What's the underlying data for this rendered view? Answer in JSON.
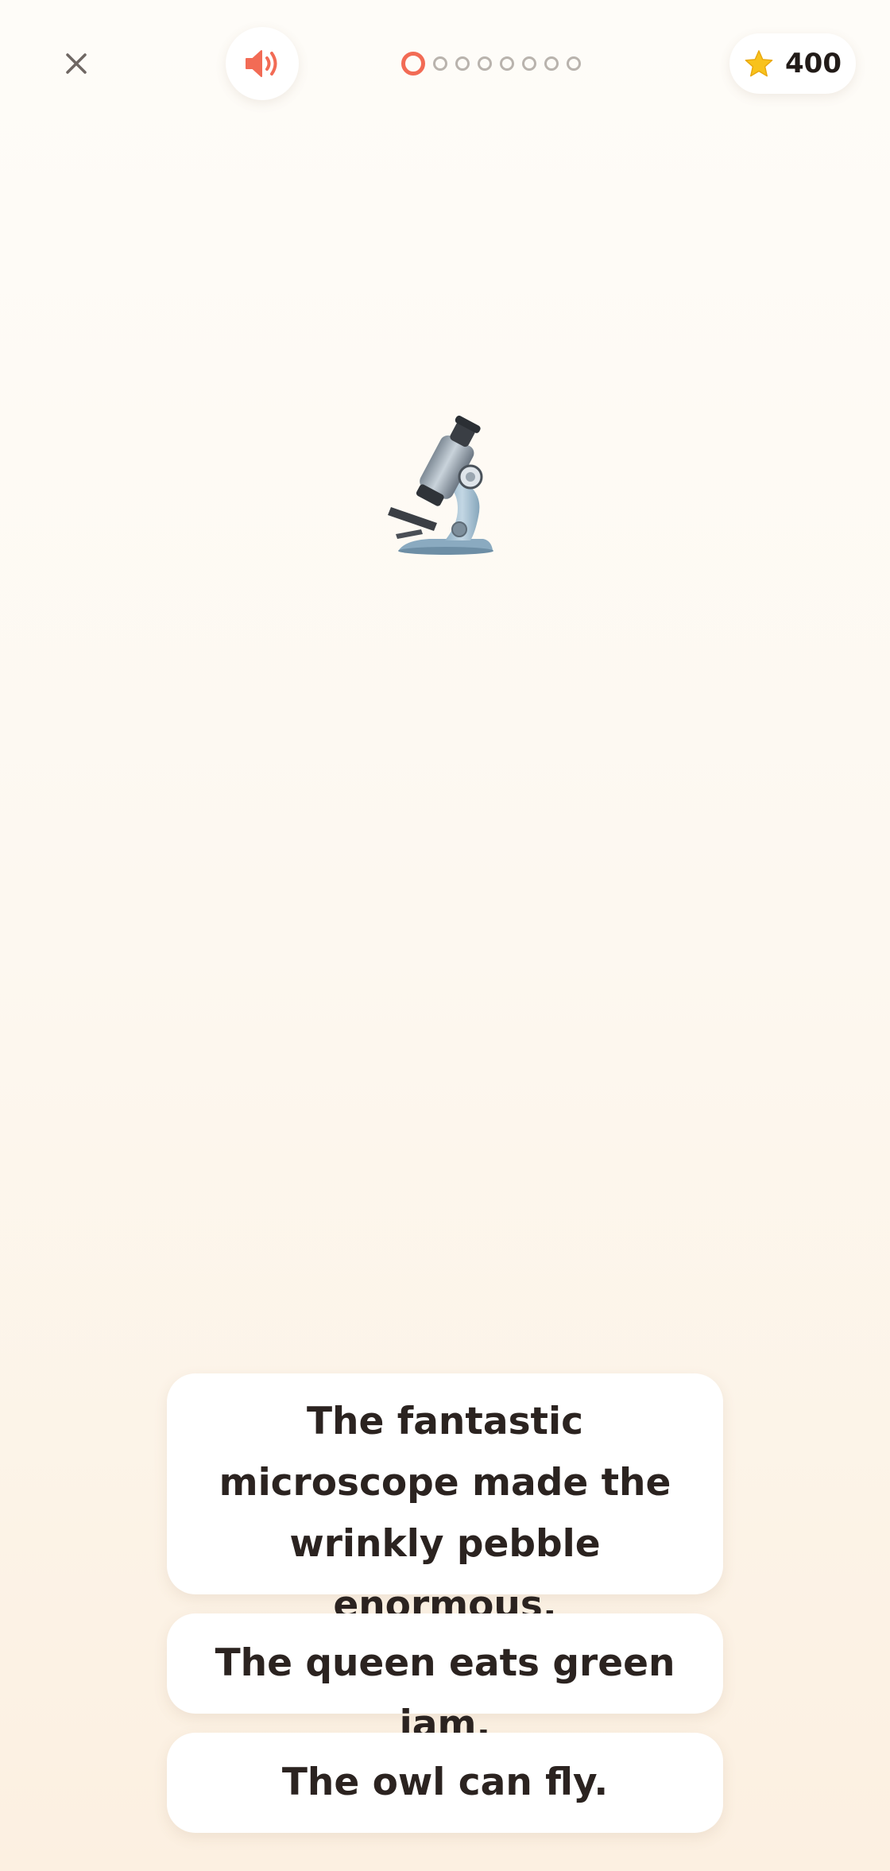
{
  "header": {
    "close_icon": "close-icon",
    "sound_icon": "speaker-icon",
    "progress": {
      "total": 8,
      "current": 1
    },
    "score": {
      "icon": "star-icon",
      "value": "400"
    }
  },
  "prompt": {
    "image_icon": "microscope-icon"
  },
  "options": [
    "The fantastic microscope made the wrinkly pebble enormous.",
    "The queen eats green jam.",
    "The owl can fly."
  ],
  "colors": {
    "accent": "#f26b55",
    "text": "#2b2320",
    "background_top": "#fefcf8",
    "background_bottom": "#fcf0e1",
    "star": "#f8c21c"
  }
}
